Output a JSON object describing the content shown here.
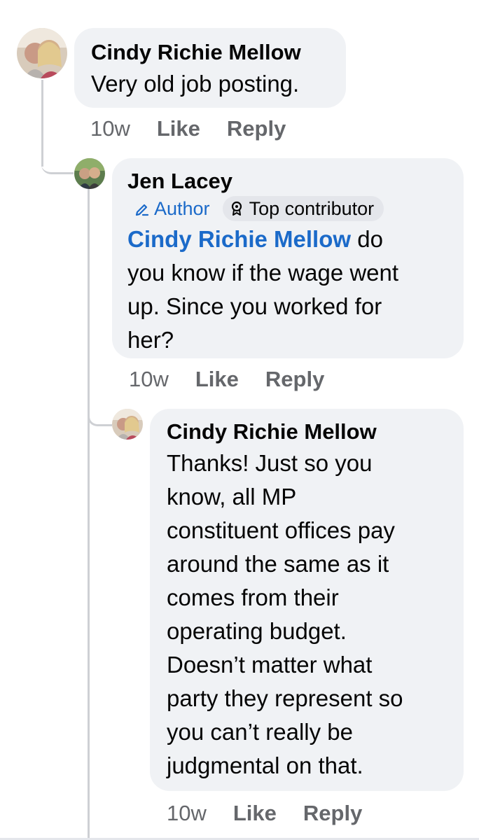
{
  "comments": [
    {
      "author": "Cindy Richie Mellow",
      "text": "Very old job posting.",
      "time": "10w",
      "like_label": "Like",
      "reply_label": "Reply"
    },
    {
      "author": "Jen Lacey",
      "badges": {
        "author_label": "Author",
        "top_contributor_label": "Top contributor"
      },
      "mention": "Cindy Richie Mellow",
      "text_lines": [
        "do",
        "you know if the wage went",
        "up. Since you worked for",
        "her?"
      ],
      "time": "10w",
      "like_label": "Like",
      "reply_label": "Reply"
    },
    {
      "author": "Cindy Richie Mellow",
      "text_lines": [
        "Thanks!  Just so you",
        "know, all MP",
        "constituent offices pay",
        "around the same as it",
        "comes from their",
        "operating budget.",
        "Doesn’t matter what",
        "party they represent so",
        "you can’t really be",
        "judgmental on that."
      ],
      "time": "10w",
      "like_label": "Like",
      "reply_label": "Reply"
    }
  ],
  "colors": {
    "mention_link": "#1b6ac9",
    "bubble_bg": "#f0f2f5",
    "meta_text": "#65676b",
    "thread_line": "#ced0d4"
  },
  "icons": {
    "author_badge": "pencil-icon",
    "top_contributor_badge": "award-icon"
  }
}
